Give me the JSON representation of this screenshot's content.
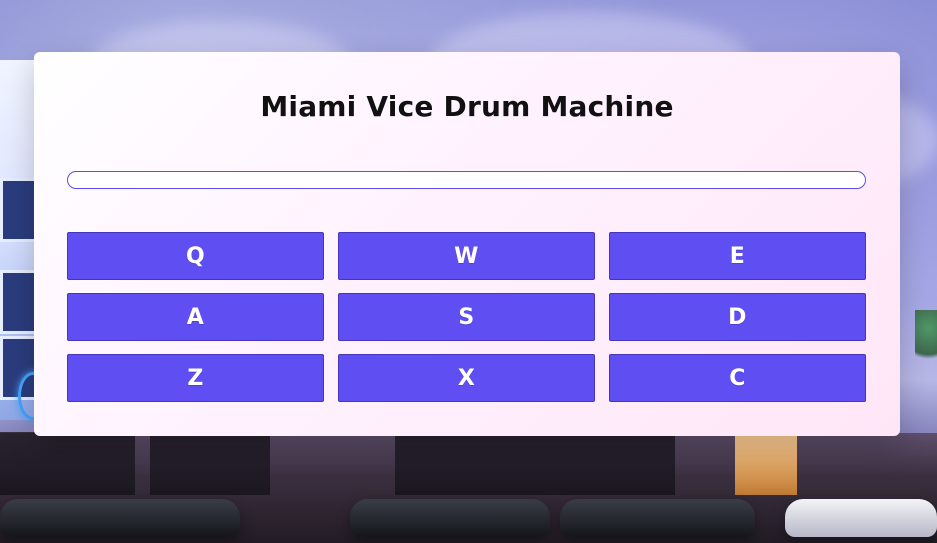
{
  "app": {
    "title": "Miami Vice Drum Machine"
  },
  "display": {
    "text": ""
  },
  "pads": [
    {
      "key": "Q"
    },
    {
      "key": "W"
    },
    {
      "key": "E"
    },
    {
      "key": "A"
    },
    {
      "key": "S"
    },
    {
      "key": "D"
    },
    {
      "key": "Z"
    },
    {
      "key": "X"
    },
    {
      "key": "C"
    }
  ],
  "colors": {
    "pad": "#5f4ef1",
    "panel_top_left": "#ffffff",
    "panel_bottom_right": "#ffe6f7",
    "display_border": "#5b4df0",
    "title": "#111111"
  },
  "icons": {
    "background": "miami-street-scene"
  }
}
